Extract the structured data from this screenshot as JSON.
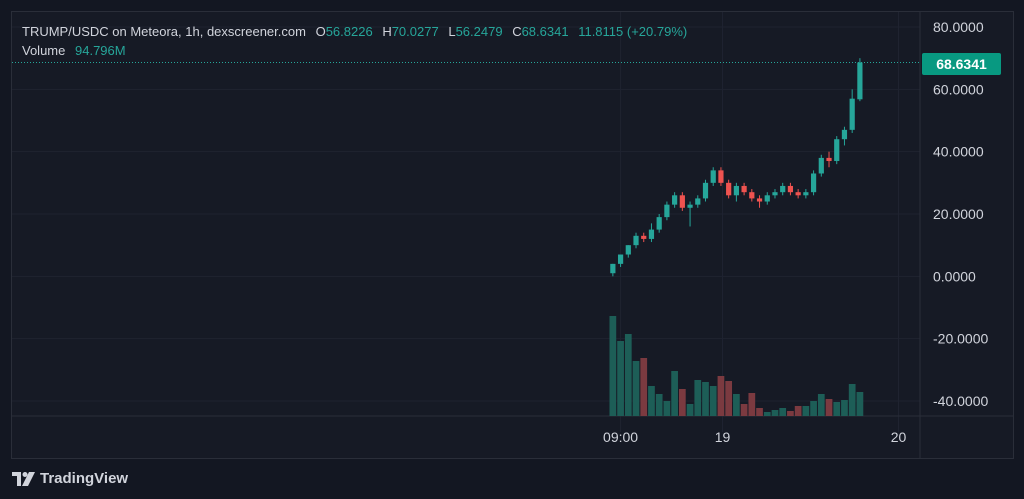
{
  "legend": {
    "symbol": "TRUMP/USDC on Meteora, 1h, dexscreener.com",
    "o_label": "O",
    "o_value": "56.8226",
    "h_label": "H",
    "h_value": "70.0277",
    "l_label": "L",
    "l_value": "56.2479",
    "c_label": "C",
    "c_value": "68.6341",
    "change": "11.8115 (+20.79%)",
    "volume_label": "Volume",
    "volume_value": "94.796M"
  },
  "last_price": "68.6341",
  "footer": {
    "brand": "TradingView"
  },
  "colors": {
    "up": "#26a69a",
    "down": "#ef5350",
    "vol_up": "#1d5e57",
    "vol_down": "#7b3a40",
    "grid": "#1f2330",
    "background": "#161a25"
  },
  "chart_data": {
    "type": "candlestick",
    "y_ticks": [
      "80.0000",
      "60.0000",
      "40.0000",
      "20.0000",
      "0.0000",
      "-20.0000",
      "-40.0000"
    ],
    "y_tick_values": [
      80,
      60,
      40,
      20,
      0,
      -20,
      -40
    ],
    "ylim": [
      -44,
      84
    ],
    "x_ticks": [
      "09:00",
      "19",
      "20"
    ],
    "x_tick_bars": [
      1.5,
      14.7,
      37.5
    ],
    "grid": true,
    "candles": [
      {
        "o": 1,
        "h": 4,
        "l": 0,
        "c": 4,
        "v": 100
      },
      {
        "o": 4,
        "h": 7,
        "l": 3,
        "c": 7,
        "v": 75
      },
      {
        "o": 7,
        "h": 10,
        "l": 6,
        "c": 10,
        "v": 82
      },
      {
        "o": 10,
        "h": 14,
        "l": 9,
        "c": 13,
        "v": 55
      },
      {
        "o": 13,
        "h": 14,
        "l": 11,
        "c": 12,
        "v": 58
      },
      {
        "o": 12,
        "h": 17,
        "l": 11,
        "c": 15,
        "v": 30
      },
      {
        "o": 15,
        "h": 20,
        "l": 14,
        "c": 19,
        "v": 22
      },
      {
        "o": 19,
        "h": 24,
        "l": 18,
        "c": 23,
        "v": 15
      },
      {
        "o": 23,
        "h": 27,
        "l": 22,
        "c": 26,
        "v": 45
      },
      {
        "o": 26,
        "h": 27,
        "l": 21,
        "c": 22,
        "v": 27
      },
      {
        "o": 22,
        "h": 24,
        "l": 16,
        "c": 23,
        "v": 12
      },
      {
        "o": 23,
        "h": 26,
        "l": 22,
        "c": 25,
        "v": 36
      },
      {
        "o": 25,
        "h": 31,
        "l": 24,
        "c": 30,
        "v": 34
      },
      {
        "o": 30,
        "h": 35,
        "l": 29,
        "c": 34,
        "v": 30
      },
      {
        "o": 34,
        "h": 35,
        "l": 29,
        "c": 30,
        "v": 40
      },
      {
        "o": 30,
        "h": 31,
        "l": 25,
        "c": 26,
        "v": 35
      },
      {
        "o": 26,
        "h": 30,
        "l": 24,
        "c": 29,
        "v": 22
      },
      {
        "o": 29,
        "h": 30,
        "l": 26,
        "c": 27,
        "v": 12
      },
      {
        "o": 27,
        "h": 28,
        "l": 24,
        "c": 25,
        "v": 23
      },
      {
        "o": 25,
        "h": 26,
        "l": 22,
        "c": 24,
        "v": 8
      },
      {
        "o": 24,
        "h": 27,
        "l": 23,
        "c": 26,
        "v": 4
      },
      {
        "o": 26,
        "h": 28,
        "l": 25,
        "c": 27,
        "v": 6
      },
      {
        "o": 27,
        "h": 30,
        "l": 26,
        "c": 29,
        "v": 8
      },
      {
        "o": 29,
        "h": 30,
        "l": 26,
        "c": 27,
        "v": 5
      },
      {
        "o": 27,
        "h": 28,
        "l": 25,
        "c": 26,
        "v": 10
      },
      {
        "o": 26,
        "h": 28,
        "l": 25,
        "c": 27,
        "v": 10
      },
      {
        "o": 27,
        "h": 34,
        "l": 26,
        "c": 33,
        "v": 15
      },
      {
        "o": 33,
        "h": 39,
        "l": 32,
        "c": 38,
        "v": 22
      },
      {
        "o": 38,
        "h": 40,
        "l": 35,
        "c": 37,
        "v": 17
      },
      {
        "o": 37,
        "h": 45,
        "l": 36,
        "c": 44,
        "v": 14
      },
      {
        "o": 44,
        "h": 48,
        "l": 42,
        "c": 47,
        "v": 16
      },
      {
        "o": 47,
        "h": 60,
        "l": 46,
        "c": 57,
        "v": 32
      },
      {
        "o": 56.8,
        "h": 70.0,
        "l": 56.2,
        "c": 68.6,
        "v": 24
      }
    ]
  }
}
